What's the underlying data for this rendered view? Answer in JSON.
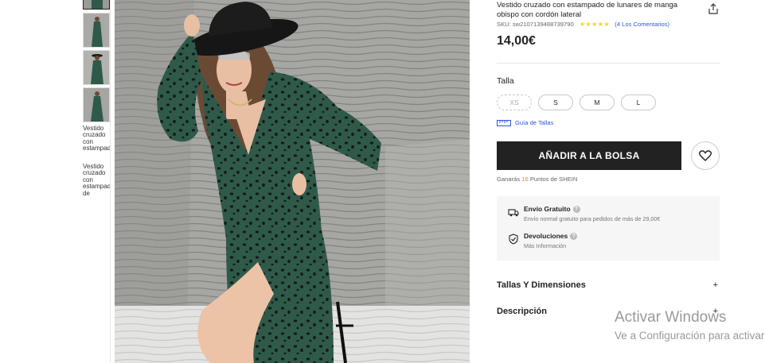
{
  "product": {
    "title": "Vestido cruzado con estampado de lunares de manga obispo con cordón lateral",
    "sku_text": "SKU: sw2107139488739790",
    "stars": "★★★★★",
    "reviews": "(4 Los Comentarios)",
    "price": "14,00€"
  },
  "thumbnails": {
    "alt_1": "Vestido cruzado con estampado",
    "alt_2": "Vestido cruzado con estampado de"
  },
  "sizes": {
    "label": "Talla",
    "options": [
      "XS",
      "S",
      "M",
      "L"
    ],
    "guide": "Guía de Tallas"
  },
  "actions": {
    "add_to_bag": "AÑADIR A LA BOLSA"
  },
  "points": {
    "prefix": "Ganarás",
    "value": "16",
    "suffix": "Puntos de SHEIN"
  },
  "shipping": {
    "title": "Envío Gratuito",
    "subtitle": "Envío normal gratuito para pedidos de más de 29,00€",
    "q": "?"
  },
  "returns": {
    "title": "Devoluciones",
    "subtitle": "Más Información",
    "q": "?"
  },
  "accordions": [
    {
      "label": "Tallas Y Dimensiones",
      "icon": "+"
    },
    {
      "label": "Descripción",
      "icon": "+"
    }
  ],
  "watermark": {
    "title": "Activar Windows",
    "subtitle": "Ve a Configuración para activar Windows."
  },
  "colors": {
    "dress": "#2f5a4a",
    "dots": "#141a17",
    "accent_blue": "#2f56d6",
    "stars": "#facf19",
    "button_bg": "#222222"
  }
}
